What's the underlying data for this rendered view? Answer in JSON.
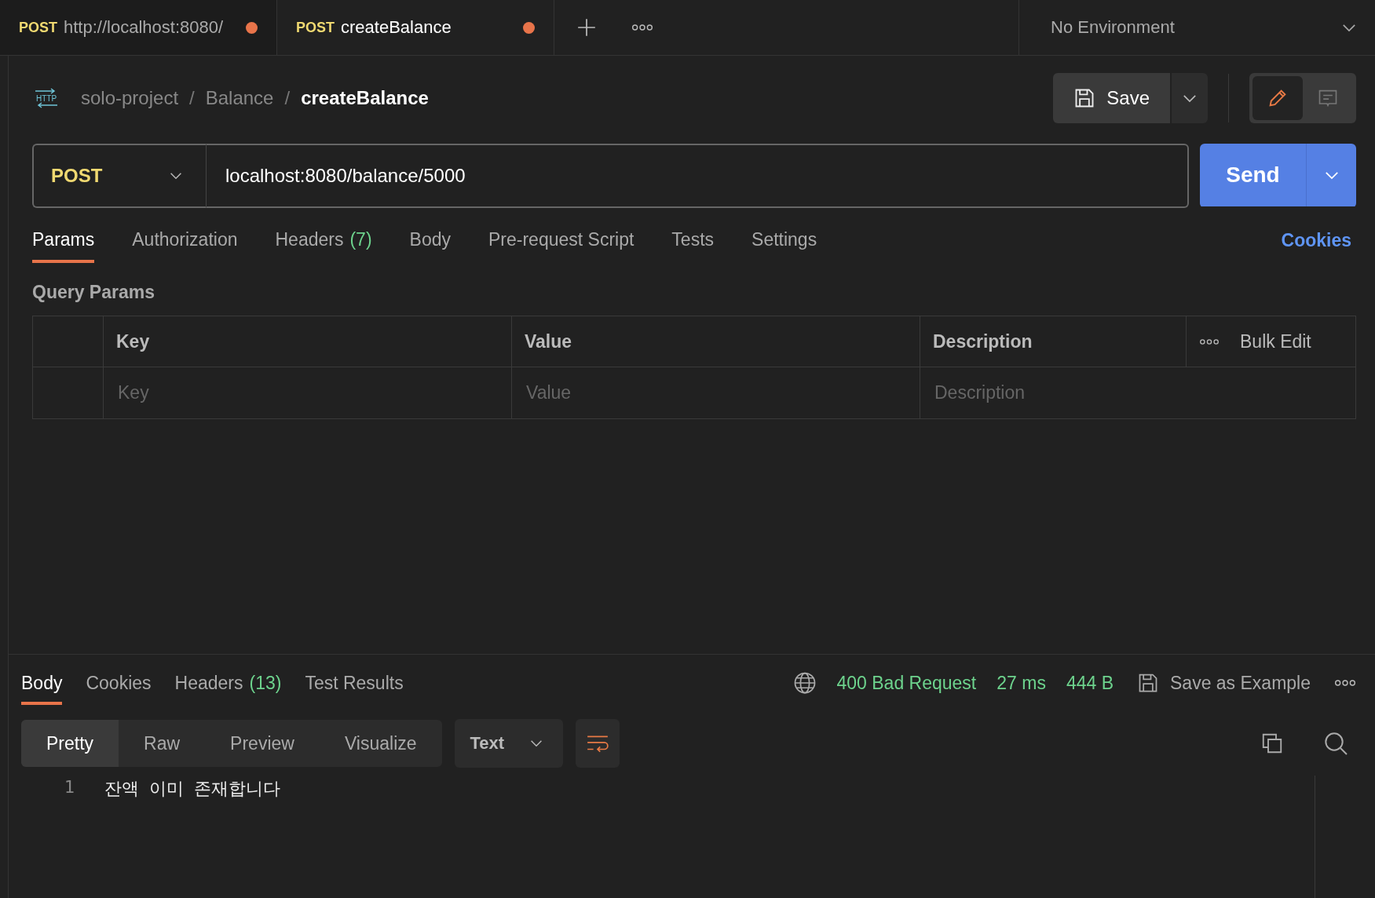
{
  "tabs": [
    {
      "method": "POST",
      "title": "http://localhost:8080/",
      "unsaved": true,
      "selected": false
    },
    {
      "method": "POST",
      "title": "createBalance",
      "unsaved": true,
      "selected": true
    }
  ],
  "environment": {
    "label": "No Environment"
  },
  "http_icon_label": "HTTP",
  "breadcrumb": [
    {
      "label": "solo-project"
    },
    {
      "separator": "/",
      "label": "Balance"
    },
    {
      "separator": "/",
      "label": "createBalance"
    }
  ],
  "save_button": {
    "label": "Save"
  },
  "request": {
    "method": "POST",
    "url": "localhost:8080/balance/5000",
    "send_label": "Send"
  },
  "request_tabs": [
    {
      "label": "Params",
      "selected": true
    },
    {
      "label": "Authorization",
      "selected": false
    },
    {
      "label": "Headers",
      "count": "(7)",
      "selected": false
    },
    {
      "label": "Body",
      "selected": false
    },
    {
      "label": "Pre-request Script",
      "selected": false
    },
    {
      "label": "Tests",
      "selected": false
    },
    {
      "label": "Settings",
      "selected": false
    }
  ],
  "cookies_link": "Cookies",
  "query_params": {
    "title": "Query Params",
    "columns": [
      "Key",
      "Value",
      "Description"
    ],
    "bulk_edit": "Bulk Edit",
    "placeholders": [
      "Key",
      "Value",
      "Description"
    ]
  },
  "response_tabs": [
    {
      "label": "Body",
      "selected": true
    },
    {
      "label": "Cookies",
      "selected": false
    },
    {
      "label": "Headers",
      "count": "(13)",
      "selected": false
    },
    {
      "label": "Test Results",
      "selected": false
    }
  ],
  "response_status": {
    "status": "400 Bad Request",
    "time": "27 ms",
    "size": "444 B",
    "save_example": "Save as Example"
  },
  "view_modes": [
    {
      "label": "Pretty",
      "selected": true
    },
    {
      "label": "Raw",
      "selected": false
    },
    {
      "label": "Preview",
      "selected": false
    },
    {
      "label": "Visualize",
      "selected": false
    }
  ],
  "format": "Text",
  "body_lines": [
    {
      "number": "1",
      "text": "잔액 이미 존재합니다"
    }
  ]
}
